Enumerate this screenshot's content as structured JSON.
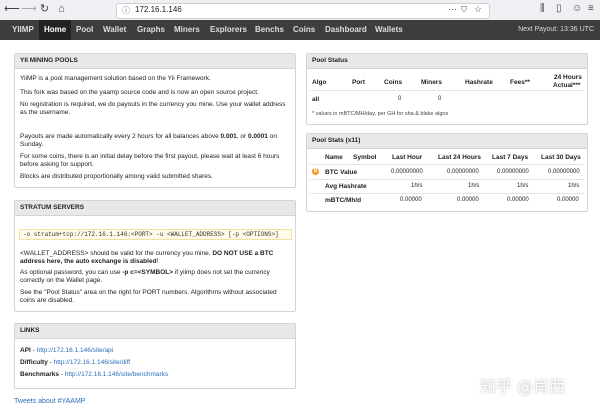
{
  "browser": {
    "url": "172.16.1.146",
    "more_icon": "⋯",
    "shield_icon": "shield-icon",
    "star_icon": "star-icon"
  },
  "nav": {
    "brand": "YIIMP",
    "items": [
      "Home",
      "Pool",
      "Wallet",
      "Graphs",
      "Miners",
      "Explorers",
      "Benchs",
      "Coins",
      "Dashboard",
      "Wallets"
    ],
    "active": "Home",
    "payout": "Next Payout: 13:36 UTC"
  },
  "mining": {
    "title": "YII MINING POOLS",
    "p1": "YiiMP is a pool management solution based on the Yii Framework.",
    "p2": "This fork was based on the yaamp source code and is now an open source project.",
    "p3a": "No registration is required, we do payouts in the currency you mine. Use your wallet address",
    "p3b": "as the username.",
    "p4a_pre": "Payouts are made automatically every 2 hours for all balances above ",
    "p4a_b1": "0.001",
    "p4a_mid": ", or ",
    "p4a_b2": "0.0001",
    "p4a_post": " on",
    "p4b": "Sunday.",
    "p5a": "For some coins, there is an initial delay before the first payout, please wait at least 6 hours",
    "p5b": "before asking for support.",
    "p6": "Blocks are distributed proportionally among valid submitted shares."
  },
  "stratum": {
    "title": "STRATUM SERVERS",
    "command": "-o stratum+tcp://172.16.1.146:<PORT> -u <WALLET_ADDRESS> [-p <OPTIONS>]",
    "w1_pre": "<WALLET_ADDRESS> should be valid for the currency you mine. ",
    "w1_bold": "DO NOT USE a BTC",
    "w2_bold": "address here, the auto exchange is disabled",
    "w2_post": "!",
    "o1_pre": "As optional password, you can use ",
    "o1_bold": "-p c=<SYMBOL>",
    "o1_post": " if yiimp does not set the currency",
    "o2": "correctly on the Wallet page.",
    "s1": "See the \"Pool Status\" area on the right for PORT numbers. Algorithms without associated",
    "s2": "coins are disabled."
  },
  "links": {
    "title": "LINKS",
    "items": [
      {
        "label": "API",
        "url": "http://172.16.1.146/site/api"
      },
      {
        "label": "Difficulty",
        "url": "http://172.16.1.146/site/diff"
      },
      {
        "label": "Benchmarks",
        "url": "http://172.16.1.146/site/benchmarks"
      }
    ]
  },
  "pool_status": {
    "title": "Pool Status",
    "headers": [
      "Algo",
      "Port",
      "Coins",
      "Miners",
      "Hashrate",
      "Fees**",
      "24 Hours",
      "Actual***"
    ],
    "row": {
      "algo": "all",
      "coins": "0",
      "miners": "0"
    },
    "note": "* values in mBTC/MH/day, per GH for sha & blake algos"
  },
  "pool_stats": {
    "title": "Pool Stats (x11)",
    "headers": [
      "Name",
      "Symbol",
      "Last Hour",
      "Last 24 Hours",
      "Last 7 Days",
      "Last 30 Days"
    ],
    "rows": [
      {
        "name": "BTC Value",
        "values": [
          "0.00000000",
          "0.00000000",
          "0.00000000",
          "0.00000000"
        ]
      },
      {
        "name": "Avg Hashrate",
        "values": [
          "1h/s",
          "1h/s",
          "1h/s",
          "1h/s"
        ]
      },
      {
        "name": "mBTC/Mh/d",
        "values": [
          "0.00000",
          "0.00000",
          "0.00000",
          "0.00000"
        ]
      }
    ]
  },
  "footer": "Tweets about #YAAMP",
  "watermark": "知乎 @肖西"
}
